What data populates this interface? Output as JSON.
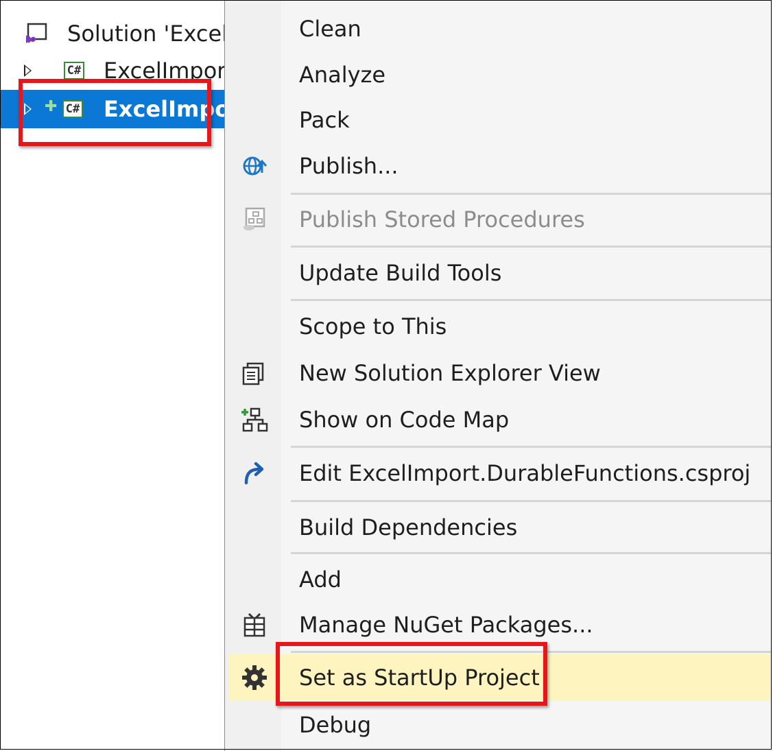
{
  "solution_explorer": {
    "solution_label": "Solution 'Excel",
    "project1_label": "ExcelImpor",
    "project2_label": "ExcelImpo",
    "csharp_badge": "C#"
  },
  "context_menu": {
    "items": [
      {
        "label": "Clean",
        "icon": ""
      },
      {
        "label": "Analyze",
        "icon": ""
      },
      {
        "label": "Pack",
        "icon": ""
      },
      {
        "label": "Publish...",
        "icon": "globe-publish-icon"
      },
      {
        "label": "Publish Stored Procedures",
        "icon": "publish-procedures-icon",
        "disabled": true
      },
      {
        "label": "Update Build Tools",
        "icon": ""
      },
      {
        "label": "Scope to This",
        "icon": ""
      },
      {
        "label": "New Solution Explorer View",
        "icon": "new-view-icon"
      },
      {
        "label": "Show on Code Map",
        "icon": "code-map-icon"
      },
      {
        "label": "Edit ExcelImport.DurableFunctions.csproj",
        "icon": "edit-arrow-icon"
      },
      {
        "label": "Build Dependencies",
        "icon": ""
      },
      {
        "label": "Add",
        "icon": ""
      },
      {
        "label": "Manage NuGet Packages...",
        "icon": "nuget-icon"
      },
      {
        "label": "Set as StartUp Project",
        "icon": "gear-icon",
        "highlighted": true
      },
      {
        "label": "Debug",
        "icon": ""
      }
    ]
  },
  "colors": {
    "selection_blue": "#0a78d4",
    "highlight_yellow": "#fdf4bf",
    "annotation_red": "#e8151b"
  }
}
